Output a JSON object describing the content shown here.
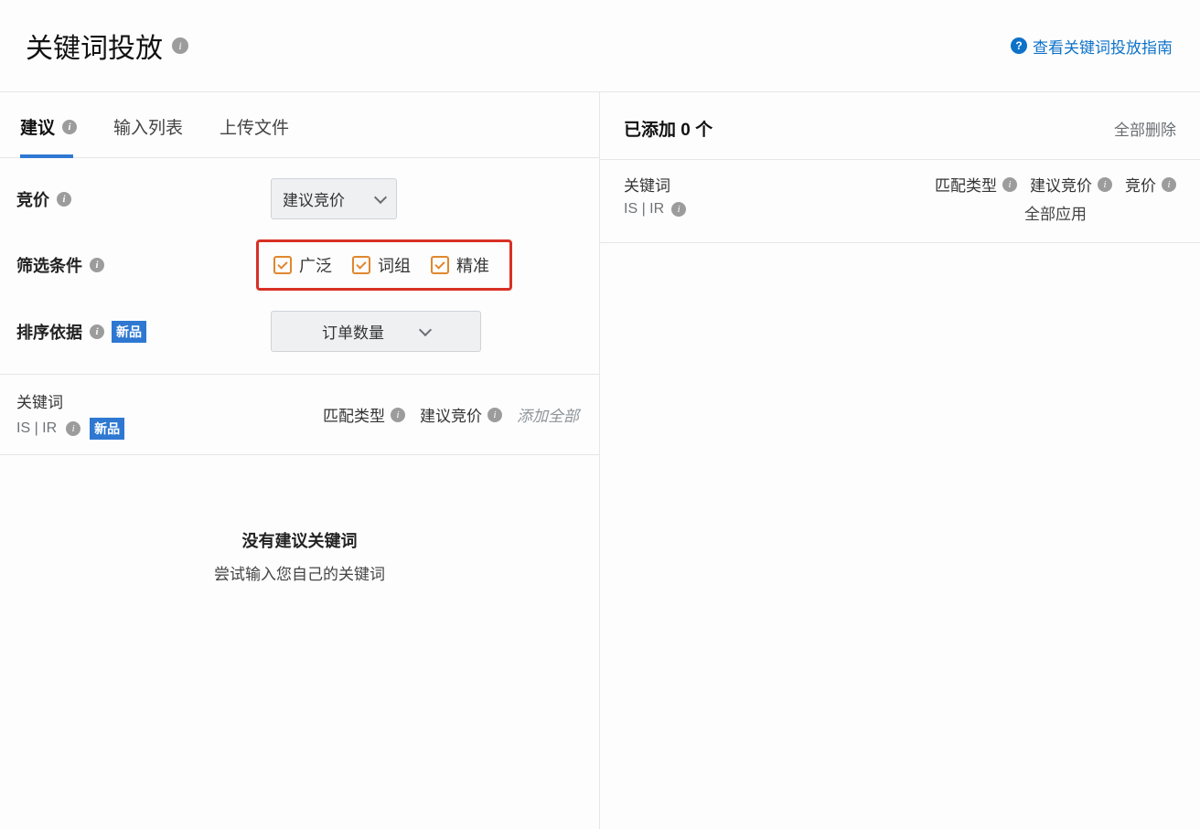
{
  "header": {
    "title": "关键词投放",
    "help_link": "查看关键词投放指南"
  },
  "tabs": {
    "suggest": "建议",
    "input_list": "输入列表",
    "upload": "上传文件"
  },
  "bid": {
    "label": "竞价",
    "dropdown": "建议竞价"
  },
  "filter": {
    "label": "筛选条件",
    "broad": "广泛",
    "phrase": "词组",
    "exact": "精准"
  },
  "sort": {
    "label": "排序依据",
    "badge": "新品",
    "dropdown": "订单数量"
  },
  "list_header": {
    "keyword": "关键词",
    "isir": "IS | IR",
    "badge": "新品",
    "match_type": "匹配类型",
    "suggest_bid": "建议竞价",
    "add_all": "添加全部"
  },
  "empty": {
    "title": "没有建议关键词",
    "sub": "尝试输入您自己的关键词"
  },
  "right": {
    "title": "已添加 0 个",
    "remove_all": "全部删除",
    "keyword": "关键词",
    "isir": "IS | IR",
    "match_type": "匹配类型",
    "suggest_bid": "建议竞价",
    "bid": "竞价",
    "apply_all": "全部应用"
  }
}
